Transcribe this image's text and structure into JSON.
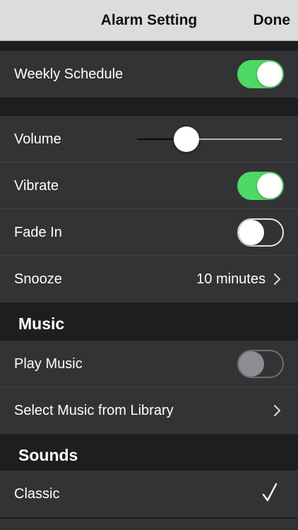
{
  "navbar": {
    "title": "Alarm Setting",
    "done_label": "Done"
  },
  "schedule": {
    "weekly_label": "Weekly Schedule",
    "weekly_on": true
  },
  "settings": {
    "volume_label": "Volume",
    "volume_level": 0.34,
    "vibrate_label": "Vibrate",
    "vibrate_on": true,
    "fade_label": "Fade In",
    "fade_on": false,
    "snooze_label": "Snooze",
    "snooze_value": "10 minutes"
  },
  "music": {
    "header": "Music",
    "play_label": "Play Music",
    "play_on": false,
    "play_enabled": false,
    "library_label": "Select Music from Library"
  },
  "sounds": {
    "header": "Sounds",
    "items": [
      {
        "label": "Classic",
        "selected": true
      }
    ]
  },
  "colors": {
    "switch_on": "#4cd964",
    "navbar_bg": "#dcdcdc",
    "row_bg": "#333336",
    "page_bg": "#1e1e21"
  },
  "icons": {
    "chevron": "chevron-right-icon",
    "check": "checkmark-icon"
  }
}
